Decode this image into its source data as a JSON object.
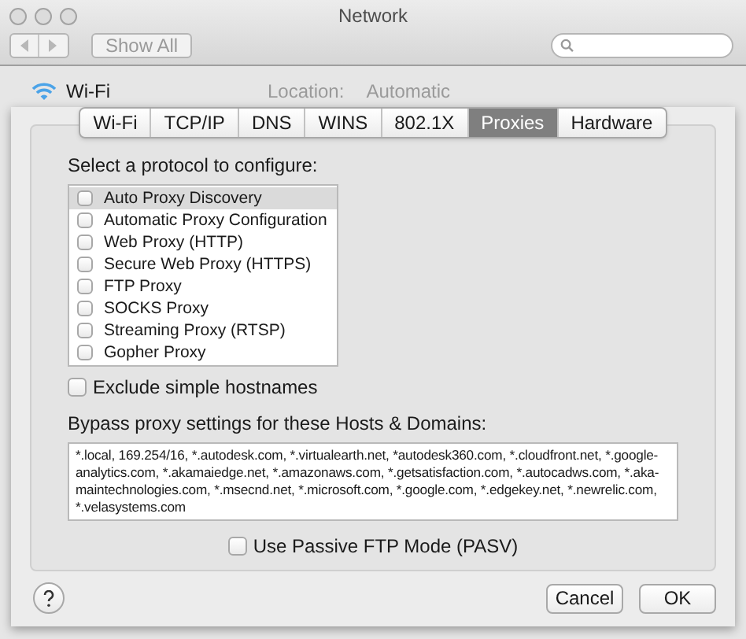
{
  "window": {
    "title": "Network"
  },
  "toolbar": {
    "show_all": "Show All"
  },
  "service": {
    "name": "Wi-Fi"
  },
  "location": {
    "label": "Location:",
    "value": "Automatic"
  },
  "tabs": [
    {
      "label": "Wi-Fi",
      "selected": false
    },
    {
      "label": "TCP/IP",
      "selected": false
    },
    {
      "label": "DNS",
      "selected": false
    },
    {
      "label": "WINS",
      "selected": false
    },
    {
      "label": "802.1X",
      "selected": false
    },
    {
      "label": "Proxies",
      "selected": true
    },
    {
      "label": "Hardware",
      "selected": false
    }
  ],
  "protocols": {
    "label": "Select a protocol to configure:",
    "items": [
      {
        "label": "Auto Proxy Discovery",
        "checked": false,
        "selected": true
      },
      {
        "label": "Automatic Proxy Configuration",
        "checked": false,
        "selected": false
      },
      {
        "label": "Web Proxy (HTTP)",
        "checked": false,
        "selected": false
      },
      {
        "label": "Secure Web Proxy (HTTPS)",
        "checked": false,
        "selected": false
      },
      {
        "label": "FTP Proxy",
        "checked": false,
        "selected": false
      },
      {
        "label": "SOCKS Proxy",
        "checked": false,
        "selected": false
      },
      {
        "label": "Streaming Proxy (RTSP)",
        "checked": false,
        "selected": false
      },
      {
        "label": "Gopher Proxy",
        "checked": false,
        "selected": false
      }
    ]
  },
  "exclude_simple_hostnames": {
    "label": "Exclude simple hostnames",
    "checked": false
  },
  "bypass": {
    "label": "Bypass proxy settings for these Hosts & Domains:",
    "value": "*.local, 169.254/16, *.autodesk.com, *.virtualearth.net, *autodesk360.com, *.cloudfront.net, *.google-analytics.com, *.akamaiedge.net, *.amazonaws.com, *.getsatisfaction.com, *.autocadws.com, *.aka-maintechnologies.com, *.msecnd.net, *.microsoft.com, *.google.com, *.edgekey.net, *.newrelic.com, *.velasystems.com"
  },
  "passive_ftp": {
    "label": "Use Passive FTP Mode (PASV)",
    "checked": false
  },
  "buttons": [
    {
      "label": "Cancel",
      "default": false
    },
    {
      "label": "OK",
      "default": false
    }
  ]
}
